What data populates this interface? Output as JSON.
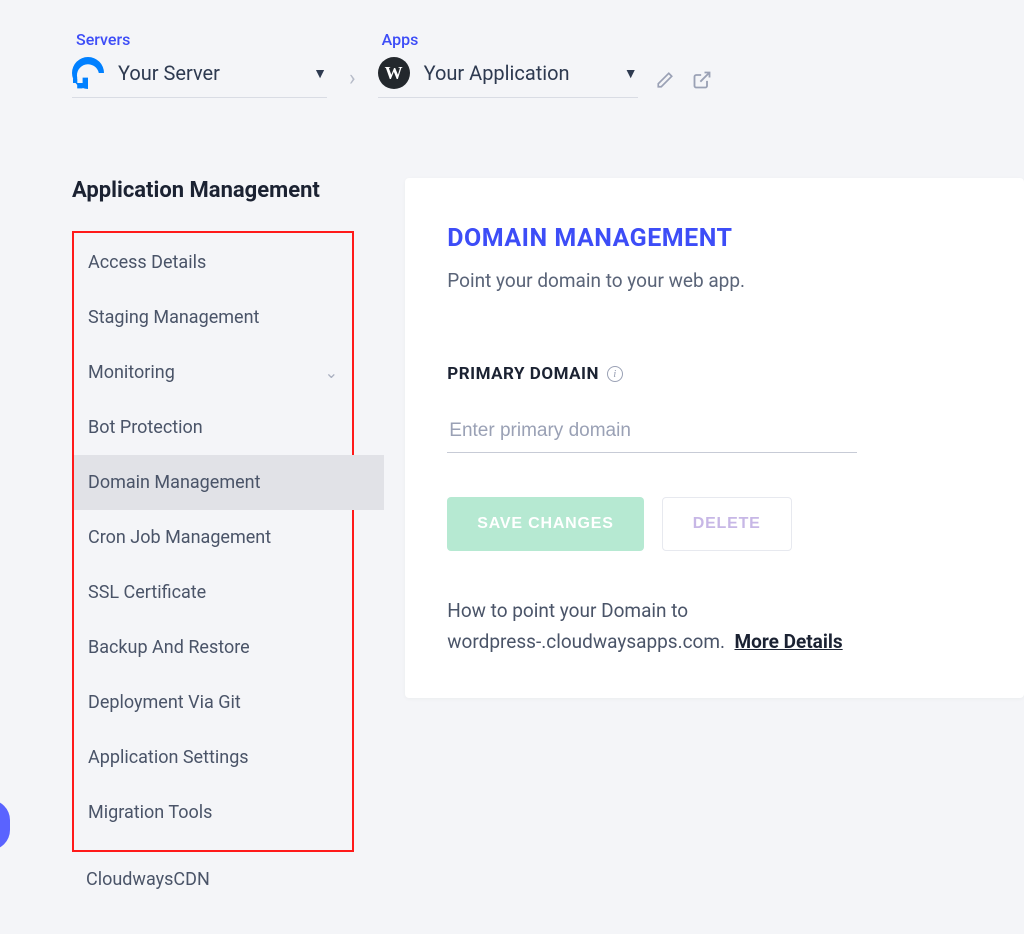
{
  "breadcrumb": {
    "servers_label": "Servers",
    "server_name": "Your Server",
    "apps_label": "Apps",
    "app_name": "Your Application"
  },
  "sidebar": {
    "title": "Application Management",
    "items": [
      {
        "label": "Access Details",
        "active": false,
        "expandable": false
      },
      {
        "label": "Staging Management",
        "active": false,
        "expandable": false
      },
      {
        "label": "Monitoring",
        "active": false,
        "expandable": true
      },
      {
        "label": "Bot Protection",
        "active": false,
        "expandable": false
      },
      {
        "label": "Domain Management",
        "active": true,
        "expandable": false
      },
      {
        "label": "Cron Job Management",
        "active": false,
        "expandable": false
      },
      {
        "label": "SSL Certificate",
        "active": false,
        "expandable": false
      },
      {
        "label": "Backup And Restore",
        "active": false,
        "expandable": false
      },
      {
        "label": "Deployment Via Git",
        "active": false,
        "expandable": false
      },
      {
        "label": "Application Settings",
        "active": false,
        "expandable": false
      },
      {
        "label": "Migration Tools",
        "active": false,
        "expandable": false
      }
    ],
    "outside_item": {
      "label": "CloudwaysCDN"
    }
  },
  "main": {
    "title": "DOMAIN MANAGEMENT",
    "subtitle": "Point your domain to your web app.",
    "section_label": "PRIMARY DOMAIN",
    "input_placeholder": "Enter primary domain",
    "save_label": "SAVE CHANGES",
    "delete_label": "DELETE",
    "help_prefix": "How to point your Domain to wordpress-",
    "help_suffix": ".cloudwaysapps.com.",
    "more_link": "More Details"
  }
}
